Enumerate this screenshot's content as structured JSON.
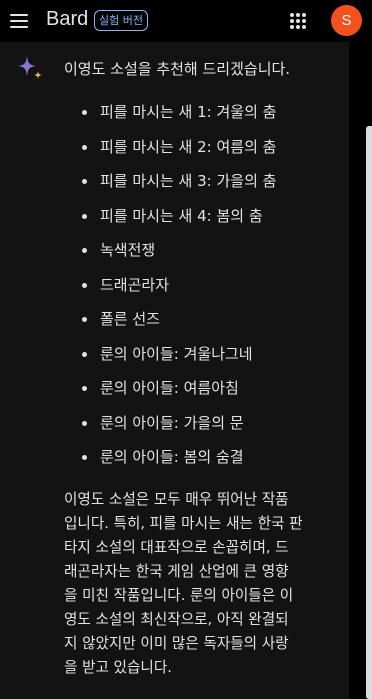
{
  "header": {
    "title": "Bard",
    "badge": "실험 버전",
    "avatar_letter": "S",
    "avatar_color": "#f4511e",
    "menu_icon": "hamburger-menu-icon",
    "apps_icon": "apps-grid-icon"
  },
  "response": {
    "icon": "sparkle-icon",
    "intro": "이영도 소설을 추천해 드리겠습니다.",
    "items": [
      "피를 마시는 새 1: 겨울의 춤",
      "피를 마시는 새 2: 여름의 춤",
      "피를 마시는 새 3: 가을의 춤",
      "피를 마시는 새 4: 봄의 춤",
      "녹색전쟁",
      "드래곤라자",
      "폴른 선즈",
      "룬의 아이들: 겨울나그네",
      "룬의 아이들: 여름아침",
      "룬의 아이들: 가을의 문",
      "룬의 아이들: 봄의 숨결"
    ],
    "summary": "이영도 소설은 모두 매우 뛰어난 작품\n입니다. 특히, 피를 마시는 새는 한국 판\n타지 소설의 대표작으로 손꼽히며, 드\n래곤라자는 한국 게임 산업에 큰 영향\n을 미친 작품입니다. 룬의 아이들은 이\n영도 소설의 최신작으로, 아직 완결되\n지 않았지만 이미 많은 독자들의 사랑\n을 받고 있습니다."
  }
}
